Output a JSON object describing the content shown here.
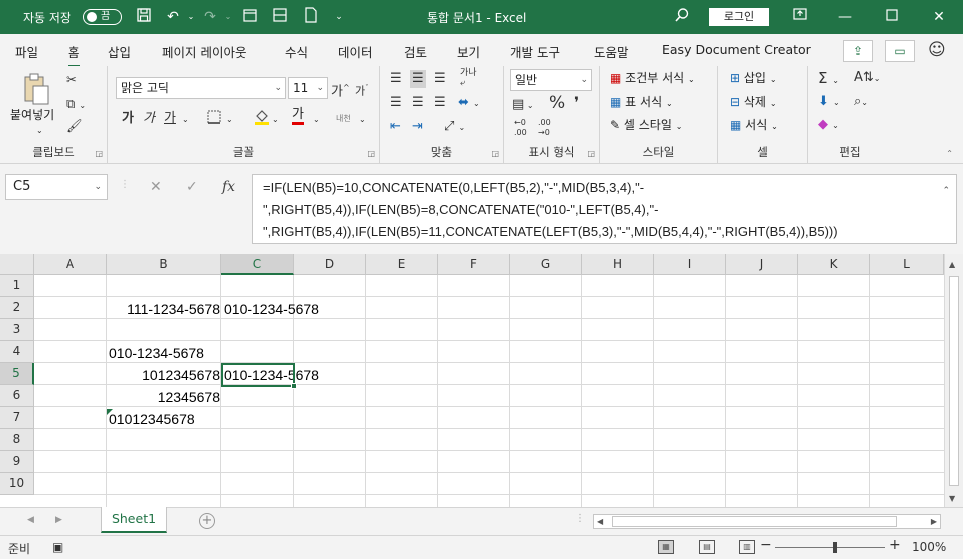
{
  "titlebar": {
    "autosave_label": "자동 저장",
    "autosave_state": "끔",
    "title": "통합 문서1 - Excel",
    "login_label": "로그인"
  },
  "tabs": [
    {
      "label": "파일"
    },
    {
      "label": "홈",
      "active": true
    },
    {
      "label": "삽입"
    },
    {
      "label": "페이지 레이아웃"
    },
    {
      "label": "수식"
    },
    {
      "label": "데이터"
    },
    {
      "label": "검토"
    },
    {
      "label": "보기"
    },
    {
      "label": "개발 도구"
    },
    {
      "label": "도움말"
    },
    {
      "label": "Easy Document Creator"
    }
  ],
  "ribbon": {
    "clipboard": {
      "paste_label": "붙여넣기",
      "group_label": "클립보드"
    },
    "font": {
      "name": "맑은 고딕",
      "size": "11",
      "bold": "가",
      "italic": "가",
      "underline": "가",
      "font_color_glyph": "가",
      "phonetic": "내천",
      "group_label": "글꼴"
    },
    "alignment": {
      "group_label": "맞춤"
    },
    "number": {
      "format": "일반",
      "group_label": "표시 형식"
    },
    "styles": {
      "conditional": "조건부 서식",
      "table": "표 서식",
      "cell": "셀 스타일",
      "group_label": "스타일"
    },
    "cells": {
      "insert": "삽입",
      "delete": "삭제",
      "format": "서식",
      "group_label": "셀"
    },
    "editing": {
      "group_label": "편집"
    }
  },
  "formula_bar": {
    "name_box": "C5",
    "fx": "fx",
    "formula": "=IF(LEN(B5)=10,CONCATENATE(0,LEFT(B5,2),\"-\",MID(B5,3,4),\"-\",RIGHT(B5,4)),IF(LEN(B5)=8,CONCATENATE(\"010-\",LEFT(B5,4),\"-\",RIGHT(B5,4)),IF(LEN(B5)=11,CONCATENATE(LEFT(B5,3),\"-\",MID(B5,4,4),\"-\",RIGHT(B5,4)),B5)))"
  },
  "grid": {
    "columns": [
      "A",
      "B",
      "C",
      "D",
      "E",
      "F",
      "G",
      "H",
      "I",
      "J",
      "K",
      "L"
    ],
    "rows": [
      "1",
      "2",
      "3",
      "4",
      "5",
      "6",
      "7",
      "8",
      "9",
      "10"
    ],
    "selected_cell": "C5",
    "cells": {
      "B2": "111-1234-5678",
      "C2": "010-1234-5678",
      "B4": "010-1234-5678",
      "B5": "1012345678",
      "C5": "010-1234-5678",
      "B6": "12345678",
      "B7": "01012345678"
    }
  },
  "sheets": [
    {
      "name": "Sheet1",
      "active": true
    }
  ],
  "status": {
    "mode": "준비",
    "zoom": "100%"
  },
  "colors": {
    "brand": "#217346"
  }
}
